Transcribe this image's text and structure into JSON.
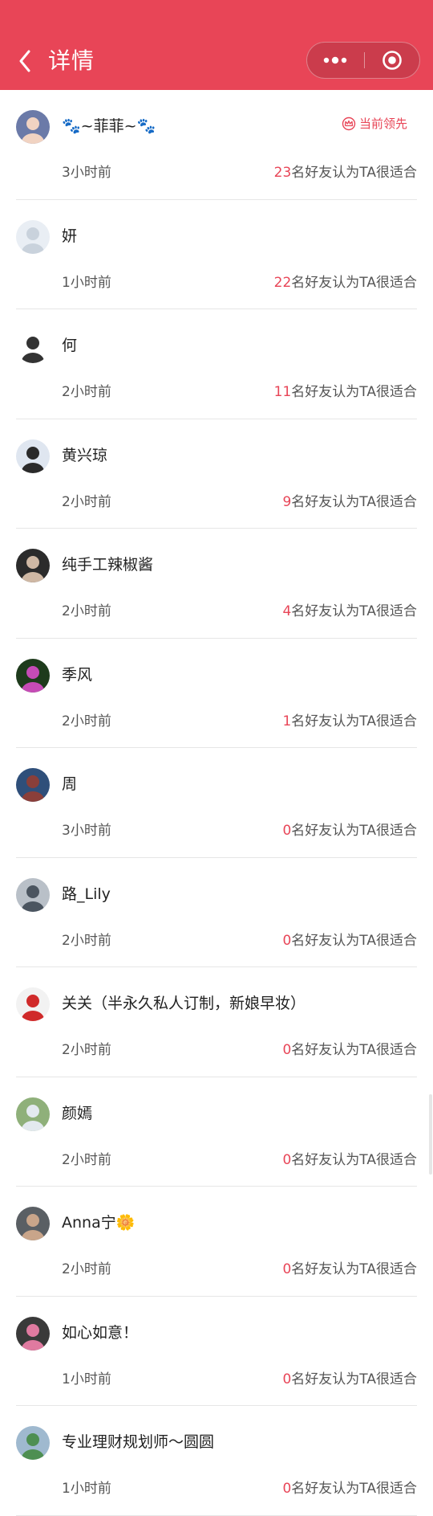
{
  "header": {
    "back_icon": "chevron-left-icon",
    "title": "详情",
    "more_icon": "more-dots-icon",
    "close_icon": "target-circle-icon",
    "bg_color": "#e84557"
  },
  "leader_badge": {
    "icon": "crown-icon",
    "label": "当前领先"
  },
  "vote_suffix": "名好友认为TA很适合",
  "accent_color": "#e84557",
  "entries": [
    {
      "name": "🐾~菲菲~🐾",
      "time": "3小时前",
      "count": "23",
      "leader": true
    },
    {
      "name": "妍",
      "time": "1小时前",
      "count": "22"
    },
    {
      "name": "何",
      "time": "2小时前",
      "count": "11"
    },
    {
      "name": "黄兴琼",
      "time": "2小时前",
      "count": "9"
    },
    {
      "name": "纯手工辣椒酱",
      "time": "2小时前",
      "count": "4"
    },
    {
      "name": "季风",
      "time": "2小时前",
      "count": "1"
    },
    {
      "name": "周",
      "time": "3小时前",
      "count": "0"
    },
    {
      "name": "路_Lily",
      "time": "2小时前",
      "count": "0"
    },
    {
      "name": "关关（半永久私人订制，新娘早妆）",
      "time": "2小时前",
      "count": "0"
    },
    {
      "name": "颜嫣",
      "time": "2小时前",
      "count": "0"
    },
    {
      "name": "Anna宁🌼",
      "time": "2小时前",
      "count": "0"
    },
    {
      "name": "如心如意！",
      "time": "1小时前",
      "count": "0"
    },
    {
      "name": "专业理财规划师～圆圆",
      "time": "1小时前",
      "count": "0"
    }
  ]
}
